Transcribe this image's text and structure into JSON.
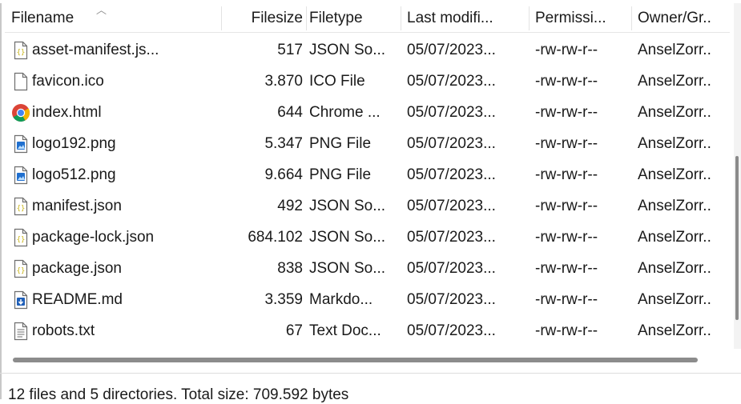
{
  "columns": {
    "name": "Filename",
    "size": "Filesize",
    "type": "Filetype",
    "modified": "Last modifi...",
    "permissions": "Permissi...",
    "owner": "Owner/Gr.."
  },
  "files": [
    {
      "name": "asset-manifest.js...",
      "size": "517",
      "type": "JSON So...",
      "modified": "05/07/2023...",
      "permissions": "-rw-rw-r--",
      "owner": "AnselZorr..",
      "icon": "json-file-icon"
    },
    {
      "name": "favicon.ico",
      "size": "3.870",
      "type": "ICO File",
      "modified": "05/07/2023...",
      "permissions": "-rw-rw-r--",
      "owner": "AnselZorr..",
      "icon": "generic-file-icon"
    },
    {
      "name": "index.html",
      "size": "644",
      "type": "Chrome ...",
      "modified": "05/07/2023...",
      "permissions": "-rw-rw-r--",
      "owner": "AnselZorr..",
      "icon": "chrome-icon"
    },
    {
      "name": "logo192.png",
      "size": "5.347",
      "type": "PNG File",
      "modified": "05/07/2023...",
      "permissions": "-rw-rw-r--",
      "owner": "AnselZorr..",
      "icon": "image-file-icon"
    },
    {
      "name": "logo512.png",
      "size": "9.664",
      "type": "PNG File",
      "modified": "05/07/2023...",
      "permissions": "-rw-rw-r--",
      "owner": "AnselZorr..",
      "icon": "image-file-icon"
    },
    {
      "name": "manifest.json",
      "size": "492",
      "type": "JSON So...",
      "modified": "05/07/2023...",
      "permissions": "-rw-rw-r--",
      "owner": "AnselZorr..",
      "icon": "json-file-icon"
    },
    {
      "name": "package-lock.json",
      "size": "684.102",
      "type": "JSON So...",
      "modified": "05/07/2023...",
      "permissions": "-rw-rw-r--",
      "owner": "AnselZorr..",
      "icon": "json-file-icon"
    },
    {
      "name": "package.json",
      "size": "838",
      "type": "JSON So...",
      "modified": "05/07/2023...",
      "permissions": "-rw-rw-r--",
      "owner": "AnselZorr..",
      "icon": "json-file-icon"
    },
    {
      "name": "README.md",
      "size": "3.359",
      "type": "Markdo...",
      "modified": "05/07/2023...",
      "permissions": "-rw-rw-r--",
      "owner": "AnselZorr..",
      "icon": "markdown-file-icon"
    },
    {
      "name": "robots.txt",
      "size": "67",
      "type": "Text Doc...",
      "modified": "05/07/2023...",
      "permissions": "-rw-rw-r--",
      "owner": "AnselZorr..",
      "icon": "text-file-icon"
    }
  ],
  "status": "12 files and 5 directories. Total size: 709.592 bytes",
  "colors": {
    "json_icon": "#c9b51a",
    "image_icon": "#1f6fcf",
    "markdown_icon": "#1f5fb8",
    "scrollbar": "#8a8a8a"
  }
}
